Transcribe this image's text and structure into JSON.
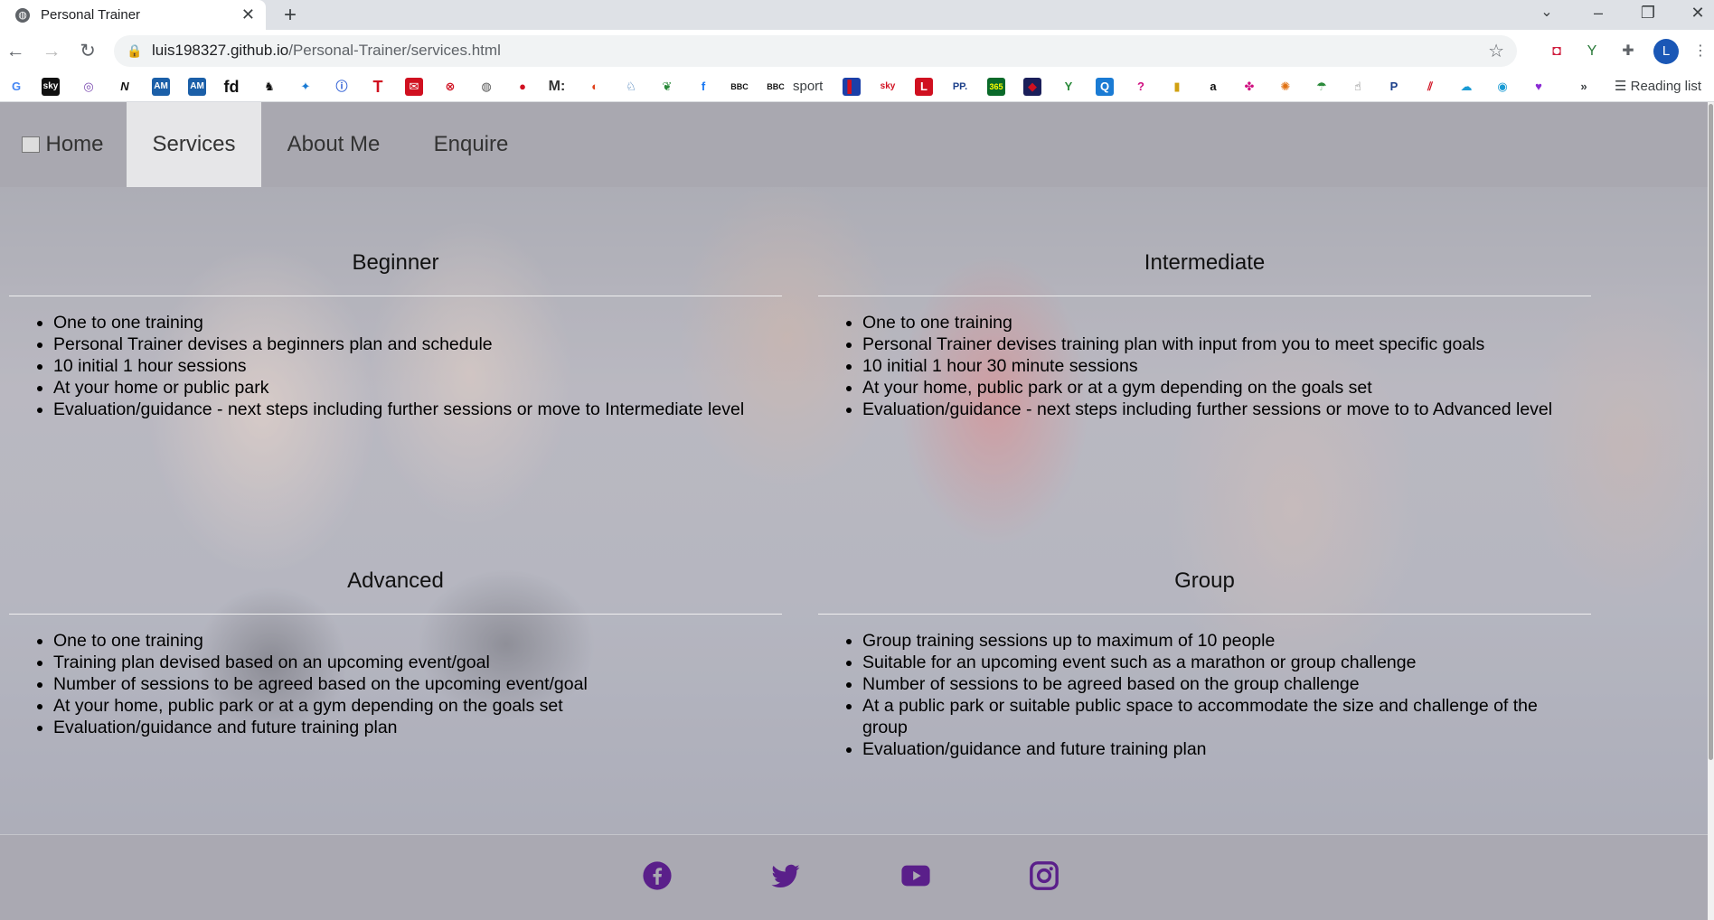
{
  "browser": {
    "tab_title": "Personal Trainer",
    "url_host": "luis198327.github.io",
    "url_path": "/Personal-Trainer/services.html",
    "profile_initial": "L",
    "bookmark_sport_label": "sport",
    "reading_list_label": "Reading list"
  },
  "nav": {
    "home": "Home",
    "services": "Services",
    "about": "About Me",
    "enquire": "Enquire"
  },
  "services": {
    "beginner": {
      "title": "Beginner",
      "items": [
        "One to one training",
        "Personal Trainer devises a beginners plan and schedule",
        "10 initial 1 hour sessions",
        "At your home or public park",
        "Evaluation/guidance - next steps including further sessions or move to Intermediate level"
      ]
    },
    "intermediate": {
      "title": "Intermediate",
      "items": [
        "One to one training",
        "Personal Trainer devises training plan with input from you to meet specific goals",
        "10 initial 1 hour 30 minute sessions",
        "At your home, public park or at a gym depending on the goals set",
        "Evaluation/guidance - next steps including further sessions or move to to Advanced level"
      ]
    },
    "advanced": {
      "title": "Advanced",
      "items": [
        "One to one training",
        "Training plan devised based on an upcoming event/goal",
        "Number of sessions to be agreed based on the upcoming event/goal",
        "At your home, public park or at a gym depending on the goals set",
        "Evaluation/guidance and future training plan"
      ]
    },
    "group": {
      "title": "Group",
      "items": [
        "Group training sessions up to maximum of 10 people",
        "Suitable for an upcoming event such as a marathon or group challenge",
        "Number of sessions to be agreed based on the group challenge",
        "At a public park or suitable public space to accommodate the size and challenge of the group",
        "Evaluation/guidance and future training plan"
      ]
    }
  },
  "footer": {
    "icons": [
      "facebook-icon",
      "twitter-icon",
      "youtube-icon",
      "instagram-icon"
    ]
  },
  "colors": {
    "social_icon": "#5a1f8a",
    "navbar_bg": "#a9a8b0",
    "active_tab_bg": "#e6e6e8"
  }
}
